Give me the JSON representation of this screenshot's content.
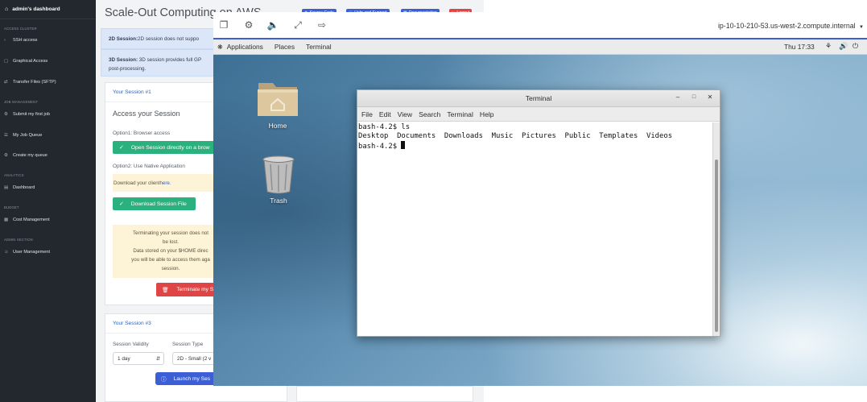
{
  "sidebar": {
    "brand": "admin's dashboard",
    "sections": {
      "access": "ACCESS CLUSTER",
      "job": "JOB MANAGEMENT",
      "analytics": "ANALYTICS",
      "budget": "BUDGET",
      "admin": "ADMIN SECTION"
    },
    "items": [
      {
        "label": "SSH access",
        "icon": "terminal-icon"
      },
      {
        "label": "Graphical Access",
        "icon": "monitor-icon"
      },
      {
        "label": "Transfer Files (SFTP)",
        "icon": "transfer-icon"
      },
      {
        "label": "Submit my first job",
        "icon": "gears-icon"
      },
      {
        "label": "My Job Queue",
        "icon": "list-icon"
      },
      {
        "label": "Create my queue",
        "icon": "gears-icon"
      },
      {
        "label": "Dashboard",
        "icon": "chart-icon"
      },
      {
        "label": "Cost Management",
        "icon": "money-icon"
      },
      {
        "label": "User Management",
        "icon": "users-icon"
      }
    ]
  },
  "page": {
    "title": "Scale-Out Computing on AWS",
    "top_buttons": {
      "source": "Source Code",
      "help": "Help and Support",
      "docs": "Documentation",
      "logout": "Logout"
    },
    "alert_2d": {
      "bold": "2D Session:",
      "text": " 2D session does not suppo"
    },
    "alert_3d": {
      "bold": "3D Session:",
      "text": " 3D session provides full GP",
      "line2": "post-processing."
    },
    "session1": {
      "header": "Your Session #1",
      "access_title": "Access your Session",
      "option1": "Option1: Browser access",
      "open_btn": "Open Session directly on a brow",
      "option2": "Option2: Use Native Application",
      "download_prefix": "Download your client ",
      "download_link": "here.",
      "download_btn": "Download Session File",
      "terminate_lines": [
        "Terminating your session does not",
        "be lost.",
        "Data stored on your $HOME direc",
        "you will be able to access them aga",
        "session."
      ],
      "terminate_btn": "Terminate my S"
    },
    "session3": {
      "header": "Your Session #3",
      "validity_label": "Session Validity",
      "validity_value": "1 day",
      "type_label": "Session Type",
      "type_value": "2D - Small (2 v",
      "launch_btn": "Launch my Ses"
    }
  },
  "dcv": {
    "hostname": "ip-10-10-210-53.us-west-2.compute.internal"
  },
  "desktop": {
    "topbar": {
      "applications": "Applications",
      "places": "Places",
      "terminal": "Terminal",
      "clock": "Thu 17:33"
    },
    "icons": {
      "home": "Home",
      "trash": "Trash"
    },
    "terminal": {
      "title": "Terminal",
      "menu": [
        "File",
        "Edit",
        "View",
        "Search",
        "Terminal",
        "Help"
      ],
      "lines": [
        "bash-4.2$ ls",
        "Desktop  Documents  Downloads  Music  Pictures  Public  Templates  Videos",
        "bash-4.2$ "
      ]
    }
  },
  "colors": {
    "sidebar_bg": "#23282e",
    "accent_blue": "#3d5fd6",
    "green": "#2bb17e",
    "red": "#e04545"
  }
}
